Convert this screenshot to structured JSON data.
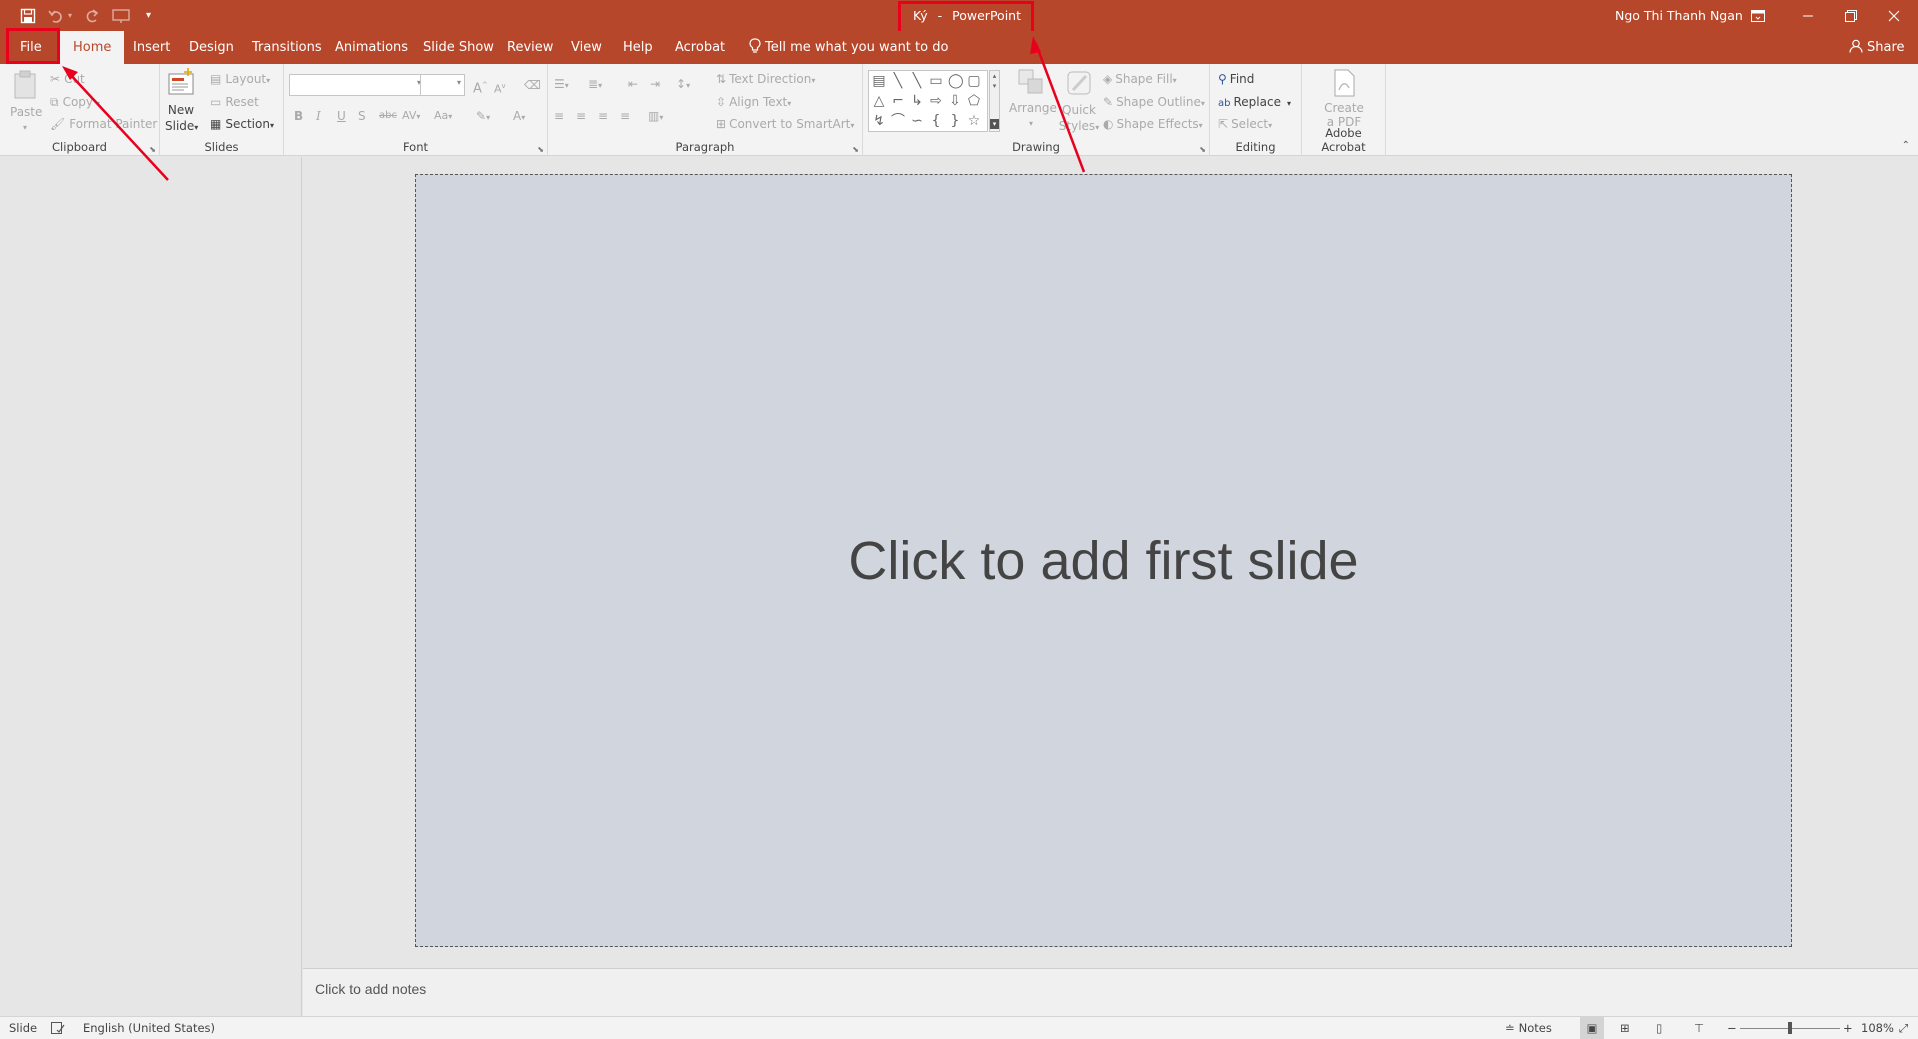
{
  "window": {
    "doc_title": "Ký",
    "separator": "-",
    "app_name": "PowerPoint",
    "user_name": "Ngo Thi Thanh Ngan",
    "accent": "#b7472a"
  },
  "tabs": {
    "file": "File",
    "home": "Home",
    "insert": "Insert",
    "design": "Design",
    "transitions": "Transitions",
    "animations": "Animations",
    "slide_show": "Slide Show",
    "review": "Review",
    "view": "View",
    "help": "Help",
    "acrobat": "Acrobat",
    "tell_me": "Tell me what you want to do",
    "share": "Share"
  },
  "ribbon": {
    "clipboard": {
      "paste": "Paste",
      "cut": "Cut",
      "copy": "Copy",
      "format_painter": "Format Painter",
      "label": "Clipboard"
    },
    "slides": {
      "new_slide_1": "New",
      "new_slide_2": "Slide",
      "layout": "Layout",
      "reset": "Reset",
      "section": "Section",
      "label": "Slides"
    },
    "font": {
      "bold": "B",
      "italic": "I",
      "underline": "U",
      "shadow": "S",
      "strike": "abc",
      "spacing": "AV",
      "case": "Aa",
      "grow": "A",
      "shrink": "A",
      "color": "A",
      "label": "Font"
    },
    "paragraph": {
      "text_direction": "Text Direction",
      "align_text": "Align Text",
      "convert_smartart": "Convert to SmartArt",
      "label": "Paragraph"
    },
    "drawing": {
      "arrange": "Arrange",
      "quick_styles_1": "Quick",
      "quick_styles_2": "Styles",
      "shape_fill": "Shape Fill",
      "shape_outline": "Shape Outline",
      "shape_effects": "Shape Effects",
      "label": "Drawing"
    },
    "editing": {
      "find": "Find",
      "replace": "Replace",
      "select": "Select",
      "label": "Editing"
    },
    "acrobat": {
      "create_1": "Create",
      "create_2": "a PDF",
      "label": "Adobe Acrobat"
    }
  },
  "slide": {
    "placeholder": "Click to add first slide"
  },
  "notes": {
    "placeholder": "Click to add notes"
  },
  "status": {
    "slide": "Slide",
    "language": "English (United States)",
    "notes": "Notes",
    "zoom": "108%"
  }
}
